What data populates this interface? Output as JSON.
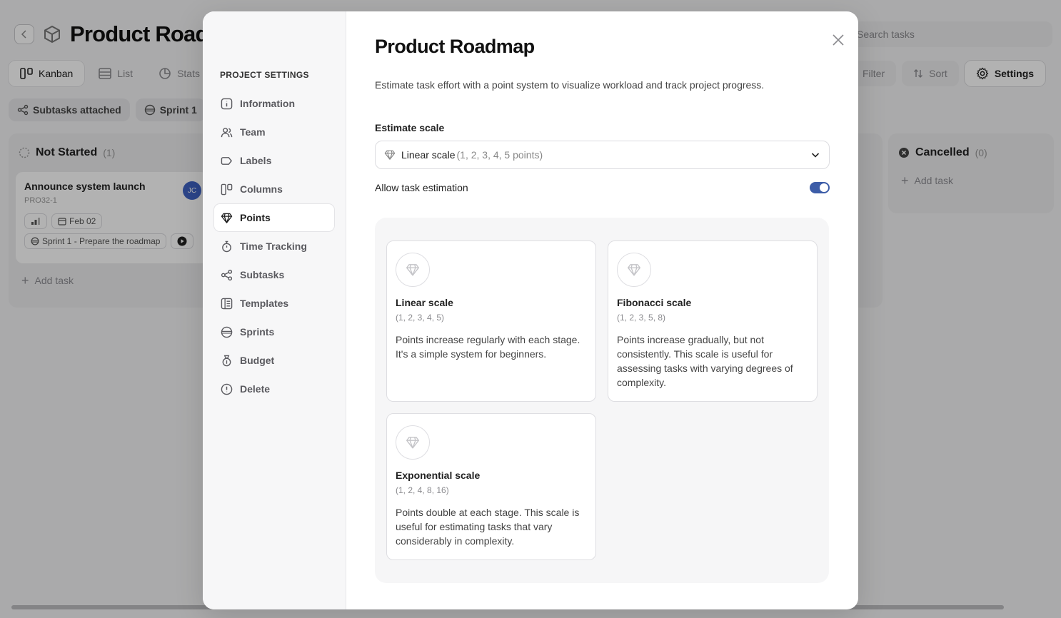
{
  "app": {
    "back_icon": "chevron-left-icon",
    "title": "Product Roadmap",
    "search_placeholder": "Search tasks"
  },
  "view_tabs": [
    {
      "label": "Kanban",
      "icon": "kanban-icon",
      "active": true
    },
    {
      "label": "List",
      "icon": "list-icon",
      "active": false
    },
    {
      "label": "Stats",
      "icon": "pie-chart-icon",
      "active": false
    }
  ],
  "tools": {
    "filter": "Filter",
    "sort": "Sort",
    "settings": "Settings"
  },
  "chips": {
    "subtasks": "Subtasks attached",
    "sprint": "Sprint 1"
  },
  "board": {
    "not_started": {
      "title": "Not Started",
      "count": "(1)"
    },
    "cancelled": {
      "title": "Cancelled",
      "count": "(0)"
    },
    "task": {
      "title": "Announce system launch",
      "id": "PRO32-1",
      "avatar": "JC",
      "date": "Feb 02",
      "sprint": "Sprint 1 - Prepare the roadmap"
    },
    "add_task": "Add task"
  },
  "settings": {
    "heading": "PROJECT SETTINGS",
    "items": [
      {
        "label": "Information",
        "icon": "info-icon"
      },
      {
        "label": "Team",
        "icon": "team-icon"
      },
      {
        "label": "Labels",
        "icon": "label-icon"
      },
      {
        "label": "Columns",
        "icon": "columns-icon"
      },
      {
        "label": "Points",
        "icon": "diamond-icon",
        "active": true
      },
      {
        "label": "Time Tracking",
        "icon": "stopwatch-icon"
      },
      {
        "label": "Subtasks",
        "icon": "subtasks-icon"
      },
      {
        "label": "Templates",
        "icon": "templates-icon"
      },
      {
        "label": "Sprints",
        "icon": "sprint-icon"
      },
      {
        "label": "Budget",
        "icon": "budget-icon"
      },
      {
        "label": "Delete",
        "icon": "alert-circle-icon"
      }
    ]
  },
  "points": {
    "title": "Product Roadmap",
    "description": "Estimate task effort with a point system to visualize workload and track project progress.",
    "scale_label": "Estimate scale",
    "selected_scale": "Linear scale",
    "selected_scale_hint": "(1, 2, 3, 4, 5 points)",
    "allow_label": "Allow task estimation",
    "allow_enabled": true,
    "scales": [
      {
        "name": "Linear scale",
        "values": "(1, 2, 3, 4, 5)",
        "description": "Points increase regularly with each stage. It's a simple system for beginners."
      },
      {
        "name": "Fibonacci scale",
        "values": "(1, 2, 3, 5, 8)",
        "description": "Points increase gradually, but not consistently. This scale is useful for assessing tasks with varying degrees of complexity."
      },
      {
        "name": "Exponential scale",
        "values": "(1, 2, 4, 8, 16)",
        "description": "Points double at each stage. This scale is useful for estimating tasks that vary considerably in complexity."
      }
    ]
  },
  "colors": {
    "accent": "#3d5da8",
    "avatar": "#3f64c5"
  }
}
